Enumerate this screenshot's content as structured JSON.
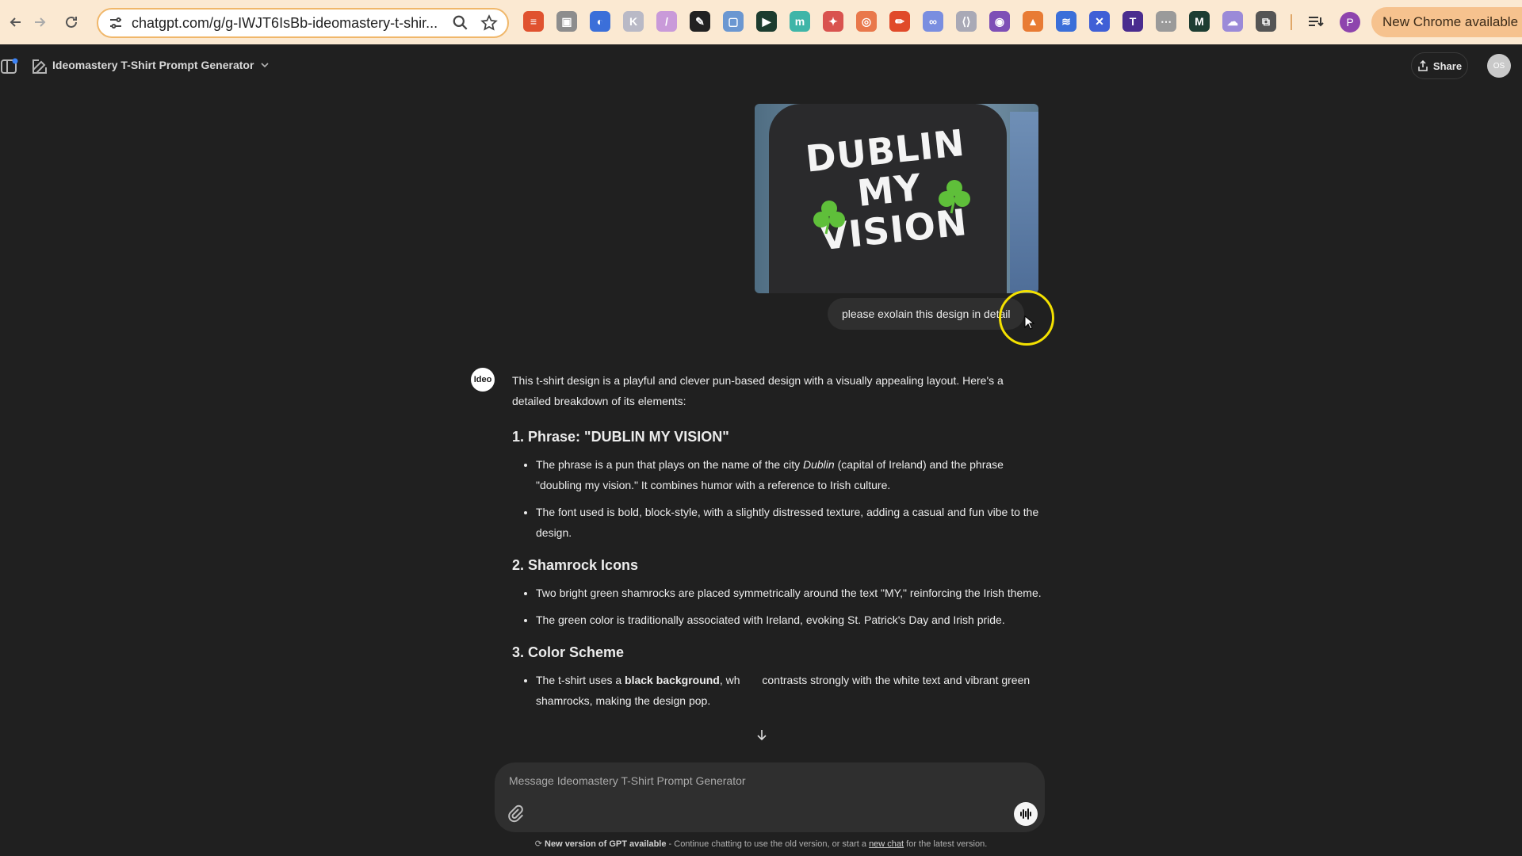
{
  "browser": {
    "url": "chatgpt.com/g/g-IWJT6IsBb-ideomastery-t-shir...",
    "update_label": "New Chrome available",
    "profile_initial": "P",
    "extensions": [
      {
        "name": "ext-red-stack",
        "color": "#e0522f",
        "glyph": "≡"
      },
      {
        "name": "ext-gray-box",
        "color": "#8d8d8d",
        "glyph": "▣"
      },
      {
        "name": "ext-blue-circle",
        "color": "#3b6fd9",
        "glyph": "◐"
      },
      {
        "name": "ext-k",
        "color": "#b9b9c6",
        "glyph": "K"
      },
      {
        "name": "ext-pen-purple",
        "color": "#c99ad9",
        "glyph": "/"
      },
      {
        "name": "ext-dropper",
        "color": "#222222",
        "glyph": "✎"
      },
      {
        "name": "ext-blue-square",
        "color": "#6b97d1",
        "glyph": "▢"
      },
      {
        "name": "ext-play-green",
        "color": "#1c3c2f",
        "glyph": "▶"
      },
      {
        "name": "ext-teal-m",
        "color": "#3fb5a8",
        "glyph": "m"
      },
      {
        "name": "ext-colorful",
        "color": "#d9534f",
        "glyph": "✦"
      },
      {
        "name": "ext-ring",
        "color": "#e9784b",
        "glyph": "◎"
      },
      {
        "name": "ext-pencil-red",
        "color": "#e04a2a",
        "glyph": "✏"
      },
      {
        "name": "ext-link",
        "color": "#7a8ee0",
        "glyph": "∞"
      },
      {
        "name": "ext-code",
        "color": "#a9a9b6",
        "glyph": "⟨⟩"
      },
      {
        "name": "ext-eye",
        "color": "#7e4fb6",
        "glyph": "◉"
      },
      {
        "name": "ext-fox",
        "color": "#e87b34",
        "glyph": "▲"
      },
      {
        "name": "ext-layers",
        "color": "#3b6fd9",
        "glyph": "≋"
      },
      {
        "name": "ext-x-blue",
        "color": "#3f5fd6",
        "glyph": "✕"
      },
      {
        "name": "ext-t",
        "color": "#4a2c8f",
        "glyph": "T"
      },
      {
        "name": "ext-grid",
        "color": "#9a9a9a",
        "glyph": "⋯"
      },
      {
        "name": "ext-m-black",
        "color": "#1d3d32",
        "glyph": "M"
      },
      {
        "name": "ext-cloud",
        "color": "#9b8ad8",
        "glyph": "☁"
      },
      {
        "name": "ext-puzzle",
        "color": "#555555",
        "glyph": "⧉"
      }
    ]
  },
  "header": {
    "gpt_name": "Ideomastery T-Shirt Prompt Generator",
    "share_label": "Share",
    "user_initials": "OS"
  },
  "conversation": {
    "user_image": {
      "line1": "DUBLIN",
      "line2": "MY",
      "line3": "VISION"
    },
    "user_message": "please exolain this design in detail",
    "assistant_avatar_text": "Ideo",
    "assistant": {
      "intro": "This t-shirt design is a playful and clever pun-based design with a visually appealing layout. Here's a detailed breakdown of its elements:",
      "sections": [
        {
          "heading": "1. Phrase: \"DUBLIN MY VISION\"",
          "bullets": [
            {
              "a": "The phrase is a pun that plays on the name of the city ",
              "em": "Dublin",
              "b": " (capital of Ireland) and the phrase \"doubling my vision.\" It combines humor with a reference to Irish culture."
            },
            {
              "a": "The font used is bold, block-style, with a slightly distressed texture, adding a casual and fun vibe to the design.",
              "em": "",
              "b": ""
            }
          ]
        },
        {
          "heading": "2. Shamrock Icons",
          "bullets": [
            {
              "a": "Two bright green shamrocks are placed symmetrically around the text \"MY,\" reinforcing the Irish theme.",
              "em": "",
              "b": ""
            },
            {
              "a": "The green color is traditionally associated with Ireland, evoking St. Patrick's Day and Irish pride.",
              "em": "",
              "b": ""
            }
          ]
        },
        {
          "heading": "3. Color Scheme",
          "bullets": [
            {
              "a": "The t-shirt uses a ",
              "strong": "black background",
              "b": ", wh",
              "c": " contrasts strongly with the white text and vibrant green shamrocks, making the design pop."
            }
          ]
        }
      ]
    }
  },
  "composer": {
    "placeholder": "Message Ideomastery T-Shirt Prompt Generator"
  },
  "footer": {
    "bold": "New version of GPT available",
    "text1": " - Continue chatting to use the old version, or start a ",
    "link": "new chat",
    "text2": " for the latest version."
  },
  "colors": {
    "browser_bar": "#fbe9d2",
    "app_bg": "#202020",
    "bubble": "#2f2f2f",
    "cursor_highlight": "#f4e100",
    "shamrock": "#5fbf3a"
  }
}
